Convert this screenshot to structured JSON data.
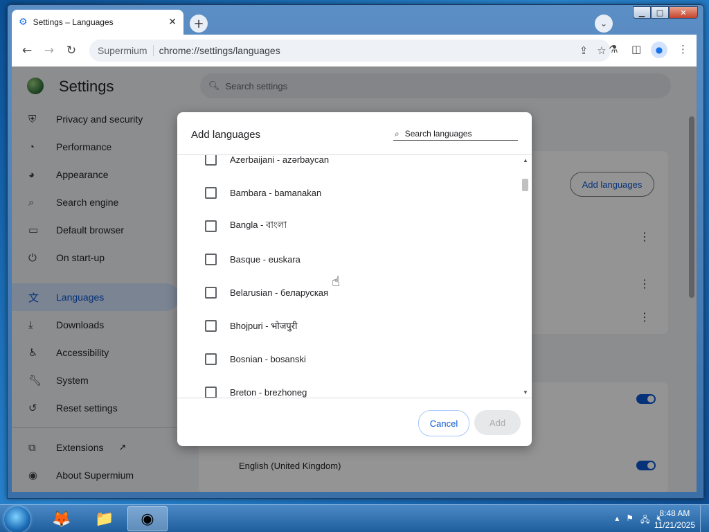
{
  "tab": {
    "title": "Settings – Languages",
    "close": "✕"
  },
  "toolbar": {
    "origin": "Supermium",
    "url": "chrome://settings/languages"
  },
  "settings": {
    "title": "Settings",
    "search_placeholder": "Search settings",
    "nav": [
      {
        "label": "Privacy and security",
        "icon": "shield-icon"
      },
      {
        "label": "Performance",
        "icon": "speedometer-icon"
      },
      {
        "label": "Appearance",
        "icon": "palette-icon"
      },
      {
        "label": "Search engine",
        "icon": "search-icon"
      },
      {
        "label": "Default browser",
        "icon": "browser-window-icon"
      },
      {
        "label": "On start-up",
        "icon": "power-icon"
      },
      {
        "label": "Languages",
        "icon": "translate-icon",
        "active": true
      },
      {
        "label": "Downloads",
        "icon": "download-icon"
      },
      {
        "label": "Accessibility",
        "icon": "accessibility-icon"
      },
      {
        "label": "System",
        "icon": "wrench-icon"
      },
      {
        "label": "Reset settings",
        "icon": "reset-icon"
      }
    ],
    "nav_bottom": [
      {
        "label": "Extensions",
        "icon": "puzzle-icon"
      },
      {
        "label": "About Supermium",
        "icon": "supermium-logo-icon"
      }
    ],
    "add_languages_button": "Add languages",
    "english_uk": "English (United Kingdom)"
  },
  "dialog": {
    "title": "Add languages",
    "search_placeholder": "Search languages",
    "languages": [
      "Azerbaijani - azərbaycan",
      "Bambara - bamanakan",
      "Bangla - বাংলা",
      "Basque - euskara",
      "Belarusian - беларуская",
      "Bhojpuri - भोजपुरी",
      "Bosnian - bosanski",
      "Breton - brezhoneg"
    ],
    "cancel": "Cancel",
    "add": "Add"
  },
  "taskbar": {
    "time": "8:48 AM",
    "date": "11/21/2025"
  },
  "colors": {
    "accent": "#0b57d0",
    "active_nav_bg": "#d3e3fd",
    "toggle_on": "#0b57d0"
  }
}
